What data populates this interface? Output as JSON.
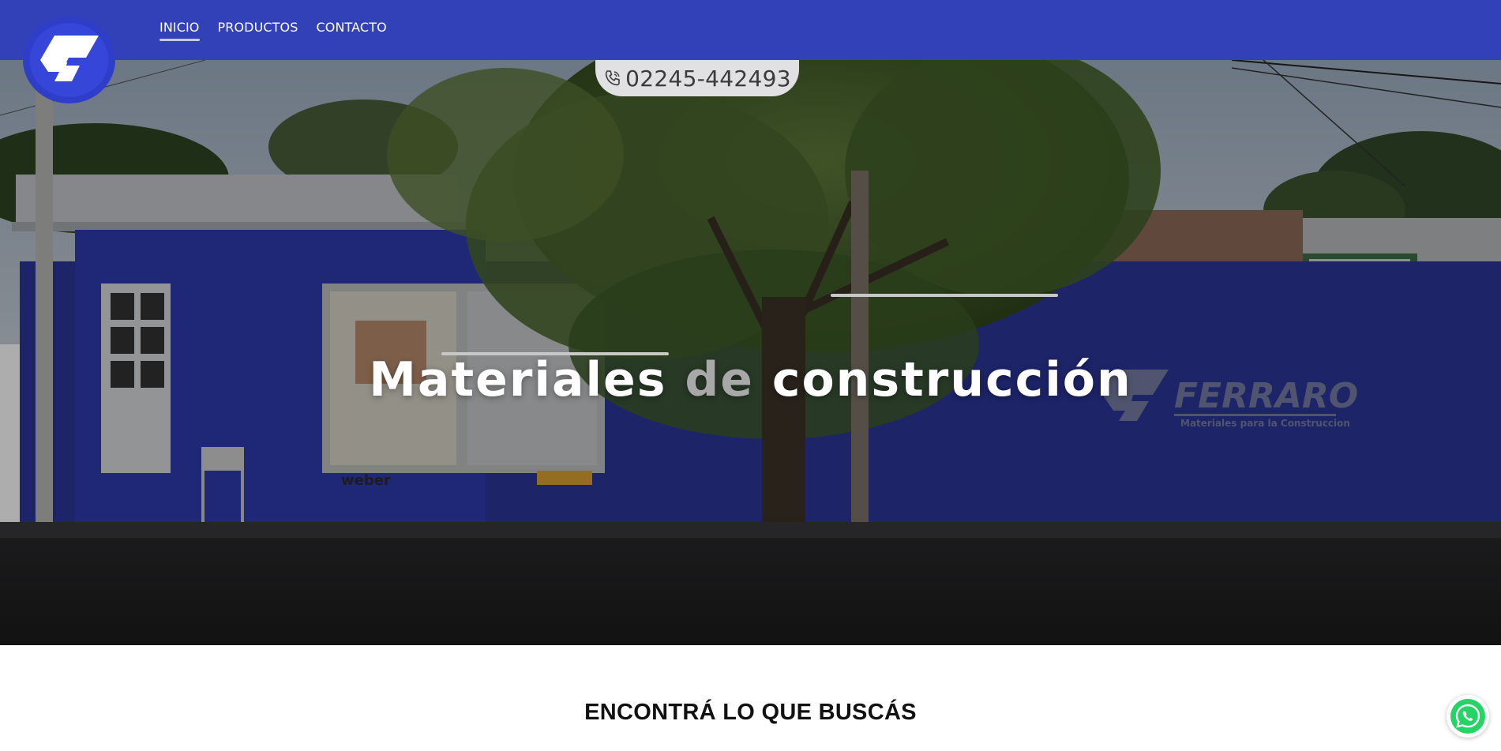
{
  "nav": {
    "brand_icon": "ferraro-logo",
    "links": [
      {
        "label": "INICIO",
        "active": true
      },
      {
        "label": "PRODUCTOS",
        "active": false
      },
      {
        "label": "CONTACTO",
        "active": false
      }
    ]
  },
  "phone": {
    "icon": "phone-icon",
    "number": "02245-442493"
  },
  "hero": {
    "title_part1": "Materiales ",
    "title_part2": "de",
    "title_part3": " construcción",
    "sign_brand": "FERRARO",
    "sign_tagline": "Materiales para la Construccion",
    "poster_brand": "weber"
  },
  "section": {
    "title": "ENCONTRÁ LO QUE BUSCÁS"
  },
  "whatsapp": {
    "icon": "whatsapp-icon"
  },
  "colors": {
    "nav_bg": "#3341b8",
    "logo_blue": "#3240c8",
    "phone_tab_bg": "#e1e1e3",
    "whatsapp_green": "#25d366"
  }
}
